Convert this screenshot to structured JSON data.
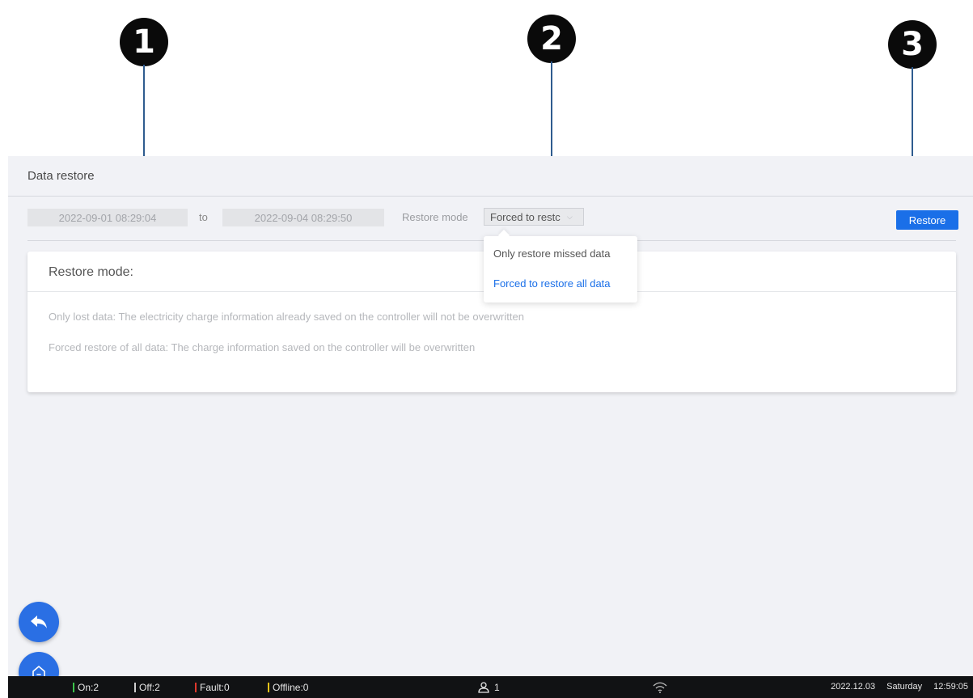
{
  "callouts": [
    "1",
    "2",
    "3"
  ],
  "panel": {
    "title": "Data restore"
  },
  "toolbar": {
    "start_date": "2022-09-01 08:29:04",
    "to_label": "to",
    "end_date": "2022-09-04 08:29:50",
    "restore_mode_label": "Restore mode",
    "restore_mode_value": "Forced to restc",
    "restore_button": "Restore"
  },
  "dropdown": {
    "options": [
      "Only restore missed data",
      "Forced to restore all data"
    ],
    "selected_index": 1
  },
  "info": {
    "title": "Restore mode:",
    "lines": [
      "Only lost data: The electricity charge information already saved on the controller will not be overwritten",
      "Forced restore of all data: The charge information saved on the controller will be overwritten"
    ]
  },
  "statusbar": {
    "on": "On:2",
    "off": "Off:2",
    "fault": "Fault:0",
    "offline": "Offline:0",
    "users": "1",
    "date": "2022.12.03",
    "day": "Saturday",
    "time": "12:59:05"
  },
  "colors": {
    "accent": "#1a6fe8",
    "on": "#3cc24a",
    "off": "#cfcfcf",
    "fault": "#e0382c",
    "offline": "#f0c419"
  },
  "icons": {
    "back": "back-arrow-icon",
    "home": "home-icon",
    "user": "user-icon",
    "wifi": "wifi-icon"
  }
}
